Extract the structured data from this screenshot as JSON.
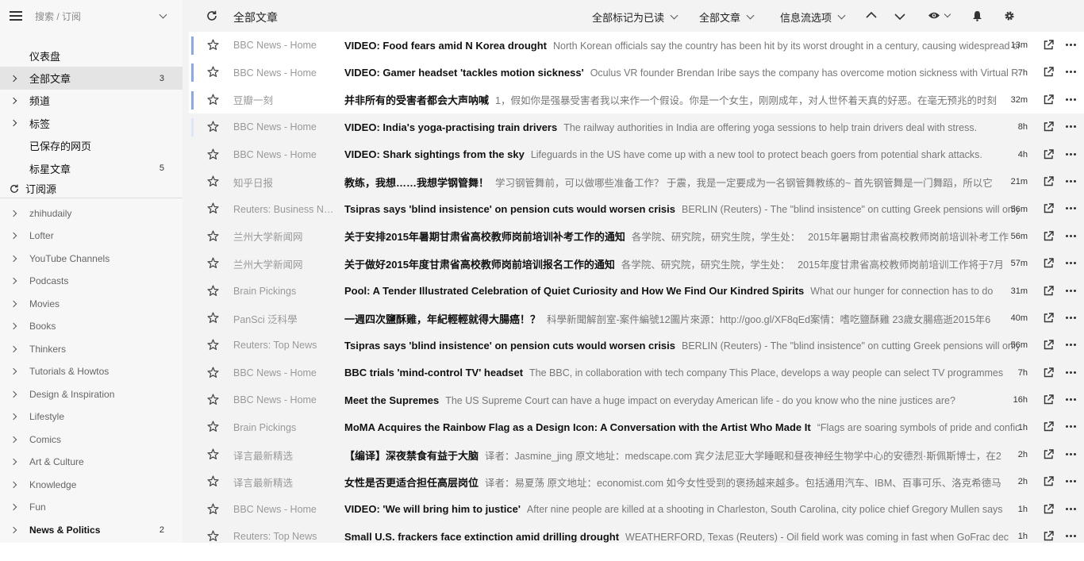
{
  "sidebar": {
    "search_placeholder": "搜索 / 订阅",
    "nav": [
      {
        "label": "仪表盘",
        "count": "",
        "arrow": false,
        "active": false
      },
      {
        "label": "全部文章",
        "count": "3",
        "arrow": true,
        "active": true
      },
      {
        "label": "频道",
        "count": "",
        "arrow": true,
        "active": false
      },
      {
        "label": "标签",
        "count": "",
        "arrow": true,
        "active": false
      },
      {
        "label": "已保存的网页",
        "count": "",
        "arrow": false,
        "active": false
      },
      {
        "label": "标星文章",
        "count": "5",
        "arrow": false,
        "active": false
      }
    ],
    "subscriptions_label": "订阅源",
    "feeds": [
      {
        "label": "zhihudaily",
        "count": ""
      },
      {
        "label": "Lofter",
        "count": ""
      },
      {
        "label": "YouTube Channels",
        "count": ""
      },
      {
        "label": "Podcasts",
        "count": ""
      },
      {
        "label": "Movies",
        "count": ""
      },
      {
        "label": "Books",
        "count": ""
      },
      {
        "label": "Thinkers",
        "count": ""
      },
      {
        "label": "Tutorials & Howtos",
        "count": ""
      },
      {
        "label": "Design & Inspiration",
        "count": ""
      },
      {
        "label": "Lifestyle",
        "count": ""
      },
      {
        "label": "Comics",
        "count": ""
      },
      {
        "label": "Art & Culture",
        "count": ""
      },
      {
        "label": "Knowledge",
        "count": ""
      },
      {
        "label": "Fun",
        "count": ""
      },
      {
        "label": "News & Politics",
        "count": "2",
        "bold": true
      }
    ]
  },
  "toolbar": {
    "title": "全部文章",
    "mark_all_read": "全部标记为已读",
    "filter": "全部文章",
    "stream_options": "信息流选项"
  },
  "articles": [
    {
      "source": "BBC News - Home",
      "title": "VIDEO: Food fears amid N Korea drought",
      "snippet": "North Korean officials say the country has been hit by its worst drought in a century, causing widespread crop failures.",
      "age": "13m",
      "state": "unread"
    },
    {
      "source": "BBC News - Home",
      "title": "VIDEO: Gamer headset 'tackles motion sickness'",
      "snippet": "Oculus VR founder Brendan Iribe says the company has overcome motion sickness with Virtual Reality.",
      "age": "7h",
      "state": "unread"
    },
    {
      "source": "豆瓣一刻",
      "title": "并非所有的受害者都会大声呐喊",
      "snippet": "1，假如你是强暴受害者我以来作一个假设。你是一个女生，刚刚成年，对人世怀着天真的好恶。在毫无预兆的时刻",
      "age": "32m",
      "state": "unread"
    },
    {
      "source": "BBC News - Home",
      "title": "VIDEO: India's yoga-practising train drivers",
      "snippet": "The railway authorities in India are offering yoga sessions to help train drivers deal with stress.",
      "age": "8h",
      "state": "read-bar"
    },
    {
      "source": "BBC News - Home",
      "title": "VIDEO: Shark sightings from the sky",
      "snippet": "Lifeguards in the US have come up with a new tool to protect beach goers from potential shark attacks.",
      "age": "4h",
      "state": "read"
    },
    {
      "source": "知乎日报",
      "title": "教练，我想……我想学钢管舞！",
      "snippet": "学习钢管舞前，可以做哪些准备工作？ 于震，我是一定要成为一名钢管舞教练的~ 首先钢管舞是一门舞蹈，所以它",
      "age": "21m",
      "state": "read"
    },
    {
      "source": "Reuters: Business News",
      "title": "Tsipras says 'blind insistence' on pension cuts would worsen crisis",
      "snippet": "BERLIN (Reuters) - The \"blind insistence\" on cutting Greek pensions will only",
      "age": "56m",
      "state": "read"
    },
    {
      "source": "兰州大学新闻网",
      "title": "关于安排2015年暑期甘肃省高校教师岗前培训补考工作的通知",
      "snippet": "各学院、研究院，研究生院，学生处：　 2015年暑期甘肃省高校教师岗前培训补考工作",
      "age": "56m",
      "state": "read"
    },
    {
      "source": "兰州大学新闻网",
      "title": "关于做好2015年度甘肃省高校教师岗前培训报名工作的通知",
      "snippet": "各学院、研究院，研究生院，学生处：　 2015年度甘肃省高校教师岗前培训工作将于7月",
      "age": "57m",
      "state": "read"
    },
    {
      "source": "Brain Pickings",
      "title": "Pool: A Tender Illustrated Celebration of Quiet Curiosity and How We Find Our Kindred Spirits",
      "snippet": "What our hunger for connection has to do",
      "age": "31m",
      "state": "read"
    },
    {
      "source": "PanSci 泛科學",
      "title": "一週四次鹽酥雞，年紀輕輕就得大腸癌！？",
      "snippet": "科學新聞解剖室-案件編號12圖片來源：http://goo.gl/XF8qEd案情：嗜吃鹽酥雞 23歲女腸癌逝2015年6",
      "age": "40m",
      "state": "read"
    },
    {
      "source": "Reuters: Top News",
      "title": "Tsipras says 'blind insistence' on pension cuts would worsen crisis",
      "snippet": "BERLIN (Reuters) - The \"blind insistence\" on cutting Greek pensions will only",
      "age": "56m",
      "state": "read"
    },
    {
      "source": "BBC News - Home",
      "title": "BBC trials 'mind-control TV' headset",
      "snippet": "The BBC, in collaboration with tech company This Place, develops a way people can select TV programmes",
      "age": "7h",
      "state": "read"
    },
    {
      "source": "BBC News - Home",
      "title": "Meet the Supremes",
      "snippet": "The US Supreme Court can have a huge impact on everyday American life - do you know who the nine justices are?",
      "age": "16h",
      "state": "read"
    },
    {
      "source": "Brain Pickings",
      "title": "MoMA Acquires the Rainbow Flag as a Design Icon: A Conversation with the Artist Who Made It",
      "snippet": "“Flags are soaring symbols of pride and confidence",
      "age": "1h",
      "state": "read"
    },
    {
      "source": "译言最新精选",
      "title": "【编译】深夜禁食有益于大脑",
      "snippet": "译者：Jasmine_jing 原文地址：medscape.com 宾夕法尼亚大学睡眠和昼夜神经生物学中心的安德烈·斯佩斯博士，在2",
      "age": "2h",
      "state": "read"
    },
    {
      "source": "译言最新精选",
      "title": "女性是否更适合担任高层岗位",
      "snippet": "译者：易夏荡 原文地址：economist.com 如今女性受到的褒扬越来越多。包括通用汽车、IBM、百事可乐、洛克希德马",
      "age": "2h",
      "state": "read"
    },
    {
      "source": "BBC News - Home",
      "title": "VIDEO: 'We will bring him to justice'",
      "snippet": "After nine people are killed at a shooting in Charleston, South Carolina, city police chief Gregory Mullen says",
      "age": "1h",
      "state": "read"
    },
    {
      "source": "Reuters: Top News",
      "title": "Small U.S. frackers face extinction amid drilling drought",
      "snippet": "WEATHERFORD, Texas (Reuters) - Oil field work was coming in fast when GoFrac dec",
      "age": "1h",
      "state": "read"
    }
  ]
}
